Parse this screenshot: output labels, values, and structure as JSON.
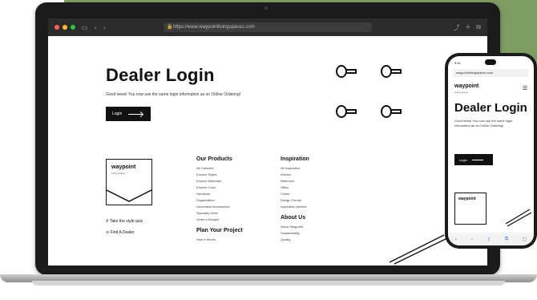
{
  "browser": {
    "url": "https://www.waypointlivingspaces.com",
    "nav_glyphs": [
      "▭",
      "‹",
      "›"
    ],
    "right_glyphs": [
      "⤴",
      "+",
      "⧉"
    ]
  },
  "page": {
    "title": "Dealer Login",
    "subtitle": "Good news! You now use the same login information as on Online Ordering!",
    "login_label": "Login"
  },
  "footer": {
    "logo_text": "waypoint",
    "logo_subtext": "living spaces",
    "side_links": [
      "Take the style quiz",
      "Find A Dealer"
    ],
    "columns": [
      {
        "heading": "Our Products",
        "items": [
          "All Cabinets",
          "Explore Styles",
          "Explore Materials",
          "Explore Color",
          "Hardware",
          "Organization",
          "Decorative Accessories",
          "Specialty Items",
          "Order a Sample"
        ]
      },
      {
        "heading": "Inspiration",
        "items": [
          "All Inspiration",
          "Kitchen",
          "Bathroom",
          "Office",
          "Closet",
          "Design Trends",
          "Inspiration Articles"
        ]
      },
      {
        "heading": "Plan Your Project",
        "items": [
          "How It Works"
        ]
      },
      {
        "heading": "About Us",
        "items": [
          "About Waypoint",
          "Sustainability",
          "Quality"
        ]
      }
    ]
  },
  "phone": {
    "time": "9:41",
    "url": "waypointlivingspaces.com",
    "logo_text": "waypoint",
    "logo_subtext": "living spaces",
    "menu_glyph": "☰",
    "title": "Dealer Login",
    "subtitle": "Good news! You now use the same login information as on Online Ordering!",
    "login_label": "Login",
    "card_text": "waypoint",
    "bottom_glyphs": [
      "‹",
      "›",
      "⇪",
      "⧉",
      "▢"
    ]
  },
  "colors": {
    "background_accent": "#7e9d62",
    "device": "#1b1b1b",
    "text": "#111111"
  }
}
